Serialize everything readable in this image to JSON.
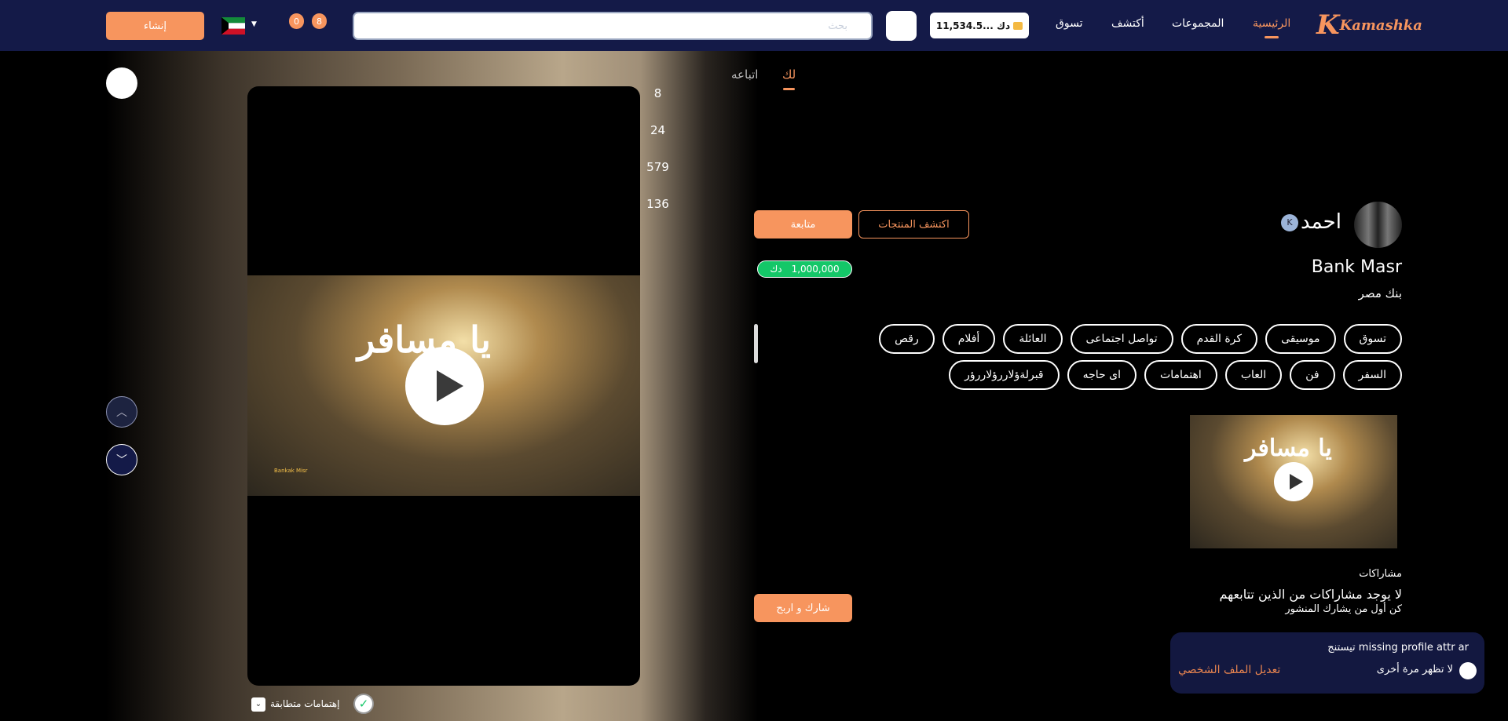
{
  "header": {
    "logo": "Kamashka",
    "nav": [
      "الرئيسية",
      "المجموعات",
      "أكتشف",
      "تسوق"
    ],
    "wallet": "11,534.5... دك",
    "search_placeholder": "بحث",
    "badges": [
      "8",
      "0"
    ],
    "create_label": "إنشاء"
  },
  "feed": {
    "tabs": [
      "لك",
      "اتباعه"
    ],
    "counts": [
      "8",
      "24",
      "579",
      "136"
    ],
    "video_title": "يا مسافر",
    "watermark": "Bankak Misr",
    "interests_label": "إهتمامات متطابقة"
  },
  "profile": {
    "name": "احمد",
    "follow_label": "متابعة",
    "discover_label": "اكتشف المنتجات",
    "balance": "1,000,000",
    "currency": "دك",
    "title": "Bank Masr",
    "subtitle": "بنك مصر",
    "tags": [
      "تسوق",
      "موسيقى",
      "كرة القدم",
      "تواصل اجتماعى",
      "العائلة",
      "أفلام",
      "رقص",
      "السفر",
      "فن",
      "العاب",
      "اهتمامات",
      "اى حاجه",
      "قبرلةؤلاررؤلاررؤر"
    ],
    "posts_label": "مشاراكات",
    "empty_title": "لا يوجد مشاراكات من الذين تتابعهم",
    "empty_sub": "كن أول من يشارك المنشور",
    "share_label": "شارك و اربح"
  },
  "toast": {
    "message": "missing profile attr ar تيستنج",
    "dont_show": "لا تظهر مرة أخرى",
    "edit_profile": "تعديل الملف الشخصي"
  },
  "colors": {
    "accent": "#f7955e",
    "navy": "#141a48",
    "green": "#14c768"
  }
}
